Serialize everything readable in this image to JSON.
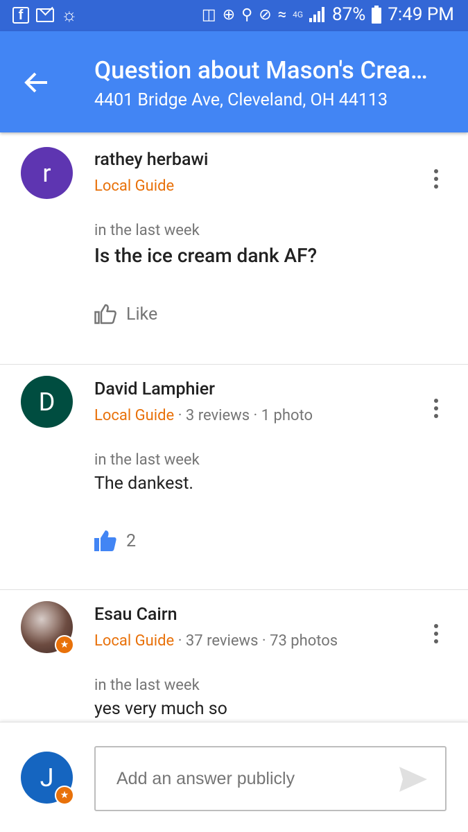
{
  "status_bar": {
    "network_label": "4G",
    "battery": "87%",
    "time": "7:49 PM"
  },
  "header": {
    "title": "Question about Mason's Crea…",
    "subtitle": "4401 Bridge Ave, Cleveland, OH 44113"
  },
  "posts": [
    {
      "avatar_letter": "r",
      "avatar_color": "#5e35b1",
      "author": "rathey herbawi",
      "guide_label": "Local Guide",
      "stats": "",
      "time": "in the last week",
      "text": "Is the ice cream dank AF?",
      "like_label": "Like"
    },
    {
      "avatar_letter": "D",
      "avatar_color": "#004d40",
      "author": "David Lamphier",
      "guide_label": "Local Guide",
      "stats": " · 3 reviews · 1 photo",
      "time": "in the last week",
      "text": "The dankest.",
      "like_count": "2"
    },
    {
      "avatar_letter": "",
      "avatar_color": "#6d4c41",
      "author": "Esau Cairn",
      "guide_label": "Local Guide",
      "stats": " · 37 reviews · 73 photos",
      "time": "in the last week",
      "text": "yes very much so"
    }
  ],
  "answer_bar": {
    "avatar_letter": "J",
    "placeholder": "Add an answer publicly"
  },
  "colors": {
    "status_bar": "#3367d6",
    "app_bar": "#4285f4",
    "local_guide": "#e8710a",
    "liked": "#4285f4"
  }
}
